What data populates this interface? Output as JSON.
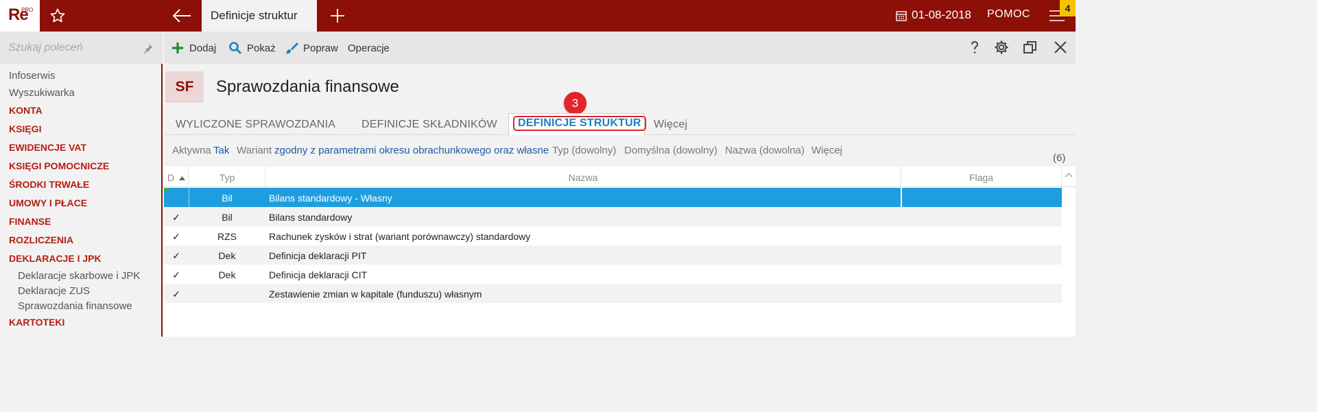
{
  "app": {
    "logo": "Re",
    "logo_sup": "PRO",
    "tab_title": "Definicje struktur",
    "date": "01-08-2018",
    "help": "POMOC",
    "notification_count": "4"
  },
  "sidebar": {
    "search_placeholder": "Szukaj poleceń",
    "items": [
      {
        "label": "Infoserwis",
        "kind": "plain"
      },
      {
        "label": "Wyszukiwarka",
        "kind": "plain"
      },
      {
        "label": "KONTA",
        "kind": "cat"
      },
      {
        "label": "KSIĘGI",
        "kind": "cat"
      },
      {
        "label": "EWIDENCJE VAT",
        "kind": "cat"
      },
      {
        "label": "KSIĘGI POMOCNICZE",
        "kind": "cat"
      },
      {
        "label": "ŚRODKI TRWAŁE",
        "kind": "cat"
      },
      {
        "label": "UMOWY I PŁACE",
        "kind": "cat"
      },
      {
        "label": "FINANSE",
        "kind": "cat"
      },
      {
        "label": "ROZLICZENIA",
        "kind": "cat"
      },
      {
        "label": "DEKLARACJE I JPK",
        "kind": "cat"
      },
      {
        "label": "Deklaracje skarbowe i JPK",
        "kind": "sub"
      },
      {
        "label": "Deklaracje ZUS",
        "kind": "sub"
      },
      {
        "label": "Sprawozdania finansowe",
        "kind": "sub"
      },
      {
        "label": "KARTOTEKI",
        "kind": "cat"
      }
    ]
  },
  "toolbar": {
    "add": "Dodaj",
    "show": "Pokaż",
    "edit": "Popraw",
    "operations": "Operacje"
  },
  "header": {
    "badge": "SF",
    "title": "Sprawozdania finansowe"
  },
  "tabs": {
    "t1": "WYLICZONE SPRAWOZDANIA",
    "t2": "DEFINICJE SKŁADNIKÓW",
    "t3": "DEFINICJE STRUKTUR",
    "more": "Więcej",
    "step": "3"
  },
  "filters": {
    "active_label": "Aktywna",
    "active_value": "Tak",
    "variant_label": "Wariant",
    "variant_value": "zgodny z parametrami okresu obrachunkowego oraz własne",
    "type": "Typ (dowolny)",
    "default": "Domyślna (dowolny)",
    "name": "Nazwa (dowolna)",
    "more": "Więcej",
    "count": "(6)"
  },
  "table": {
    "columns": {
      "d": "D",
      "typ": "Typ",
      "nazwa": "Nazwa",
      "flaga": "Flaga"
    },
    "rows": [
      {
        "d": "",
        "typ": "Bil",
        "nazwa": "Bilans standardowy - Własny",
        "flaga": ""
      },
      {
        "d": "✓",
        "typ": "Bil",
        "nazwa": "Bilans standardowy",
        "flaga": ""
      },
      {
        "d": "✓",
        "typ": "RZS",
        "nazwa": "Rachunek zysków i strat (wariant porównawczy) standardowy",
        "flaga": ""
      },
      {
        "d": "✓",
        "typ": "Dek",
        "nazwa": "Definicja deklaracji PIT",
        "flaga": ""
      },
      {
        "d": "✓",
        "typ": "Dek",
        "nazwa": "Definicja deklaracji CIT",
        "flaga": ""
      },
      {
        "d": "✓",
        "typ": "",
        "nazwa": "Zestawienie zmian w kapitale (funduszu) własnym",
        "flaga": ""
      }
    ]
  },
  "colors": {
    "brand": "#8c1007",
    "selection": "#1e9ee0",
    "link": "#1d5aa6",
    "highlight": "#e0262b"
  }
}
